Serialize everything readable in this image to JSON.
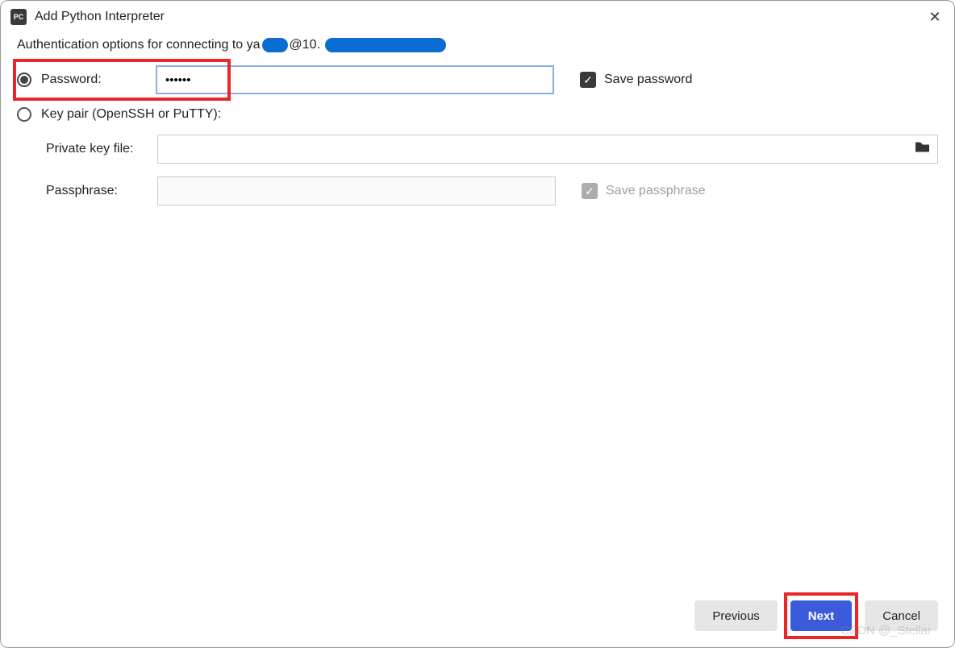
{
  "dialog": {
    "title": "Add Python Interpreter"
  },
  "auth": {
    "prefix": "Authentication options for connecting to ya",
    "mid": "@10."
  },
  "password": {
    "label": "Password:",
    "value": "••••••",
    "save_label": "Save password"
  },
  "keypair": {
    "label": "Key pair (OpenSSH or PuTTY):",
    "private_key_label": "Private key file:",
    "private_key_value": "",
    "passphrase_label": "Passphrase:",
    "passphrase_value": "",
    "save_passphrase_label": "Save passphrase"
  },
  "buttons": {
    "previous": "Previous",
    "next": "Next",
    "cancel": "Cancel"
  },
  "watermark": "CSDN @_Stellar"
}
